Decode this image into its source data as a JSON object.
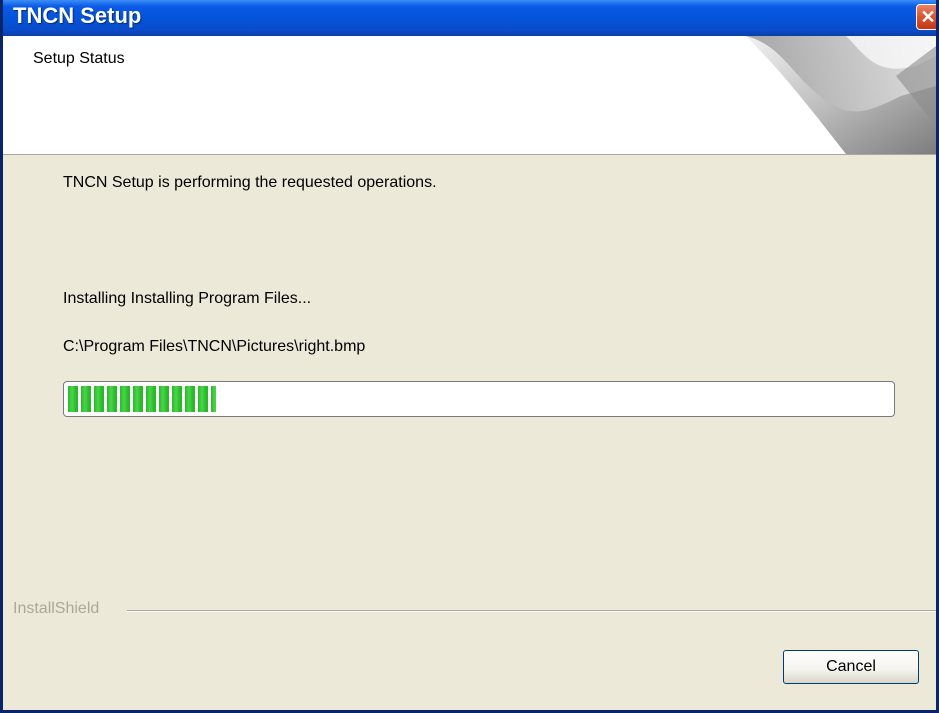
{
  "window": {
    "title": "TNCN Setup"
  },
  "header": {
    "title": "Setup Status"
  },
  "body": {
    "description": "TNCN Setup is performing the requested operations.",
    "status": "Installing Installing Program Files...",
    "current_file": "C:\\Program Files\\TNCN\\Pictures\\right.bmp"
  },
  "progress": {
    "fraction": 0.18
  },
  "footer": {
    "brand": "InstallShield",
    "cancel_label": "Cancel"
  },
  "icons": {
    "close": "close-icon",
    "header_graphic": "page-curl-graphic"
  },
  "colors": {
    "titlebar": "#0453d8",
    "progress_fill": "#2ab82a",
    "dialog_bg": "#ece9d8"
  }
}
